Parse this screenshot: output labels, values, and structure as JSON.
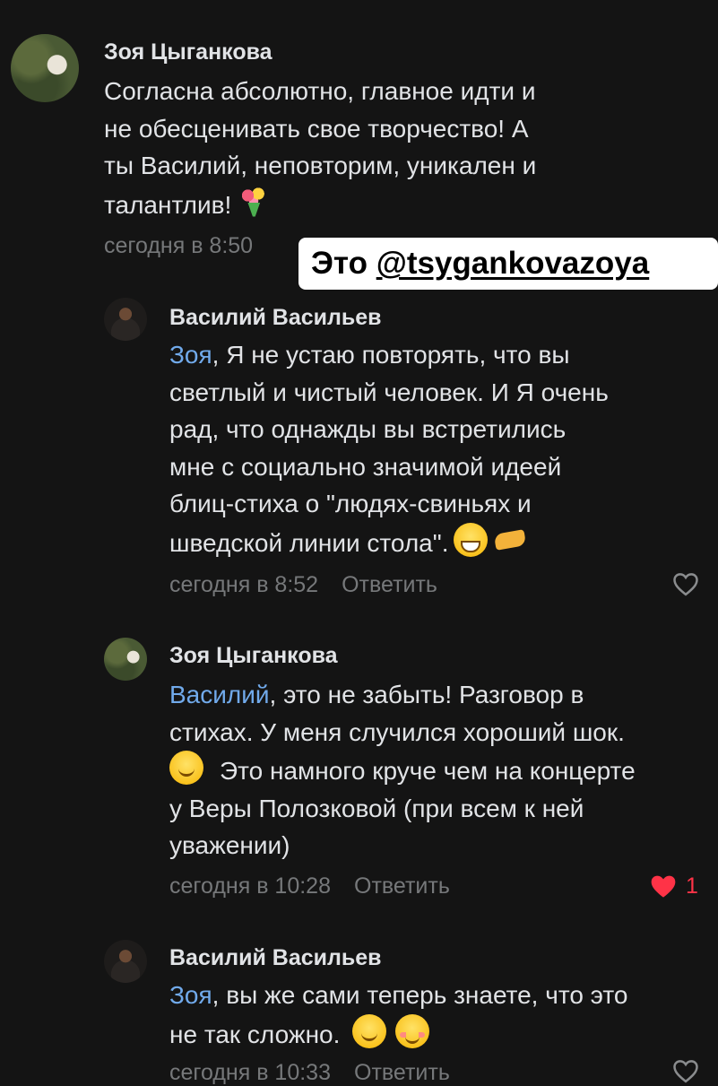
{
  "comments": [
    {
      "author": "Зоя Цыганкова",
      "lines": [
        "Согласна абсолютно, главное идти и",
        "не обесценивать свое творчество! А",
        "ты Василий, неповторим, уникален и",
        "талантлив!"
      ],
      "time": "сегодня в 8:50"
    },
    {
      "author": "Василий Васильев",
      "mention": "Зоя",
      "lines": [
        ", Я не устаю повторять, что вы",
        "светлый и чистый человек. И Я очень",
        "рад, что однажды вы встретились",
        "мне с социально значимой идеей",
        "блиц-стиха о \"людях-свиньях и",
        "шведской линии стола\"."
      ],
      "time": "сегодня в 8:52",
      "reply": "Ответить"
    },
    {
      "author": "Зоя Цыганкова",
      "mention": "Василий",
      "lines": [
        ", это не забыть! Разговор в",
        "стихах. У меня случился хороший шок.",
        "Это намного круче чем на концерте",
        "у Веры Полозковой (при всем к ней",
        "уважении)"
      ],
      "time": "сегодня в 10:28",
      "reply": "Ответить",
      "likes": "1"
    },
    {
      "author": "Василий Васильев",
      "mention": "Зоя",
      "lines": [
        ", вы же сами теперь знаете, что это",
        "не так сложно."
      ],
      "time": "сегодня в 10:33",
      "reply": "Ответить"
    }
  ],
  "overlay": {
    "prefix": "Это ",
    "handle": "@tsygankovazoya"
  },
  "colors": {
    "background": "#141414",
    "mention": "#71aaeb",
    "meta": "#76787a",
    "like": "#ff3347"
  },
  "icons": [
    "heart-outline-icon",
    "heart-filled-icon"
  ]
}
